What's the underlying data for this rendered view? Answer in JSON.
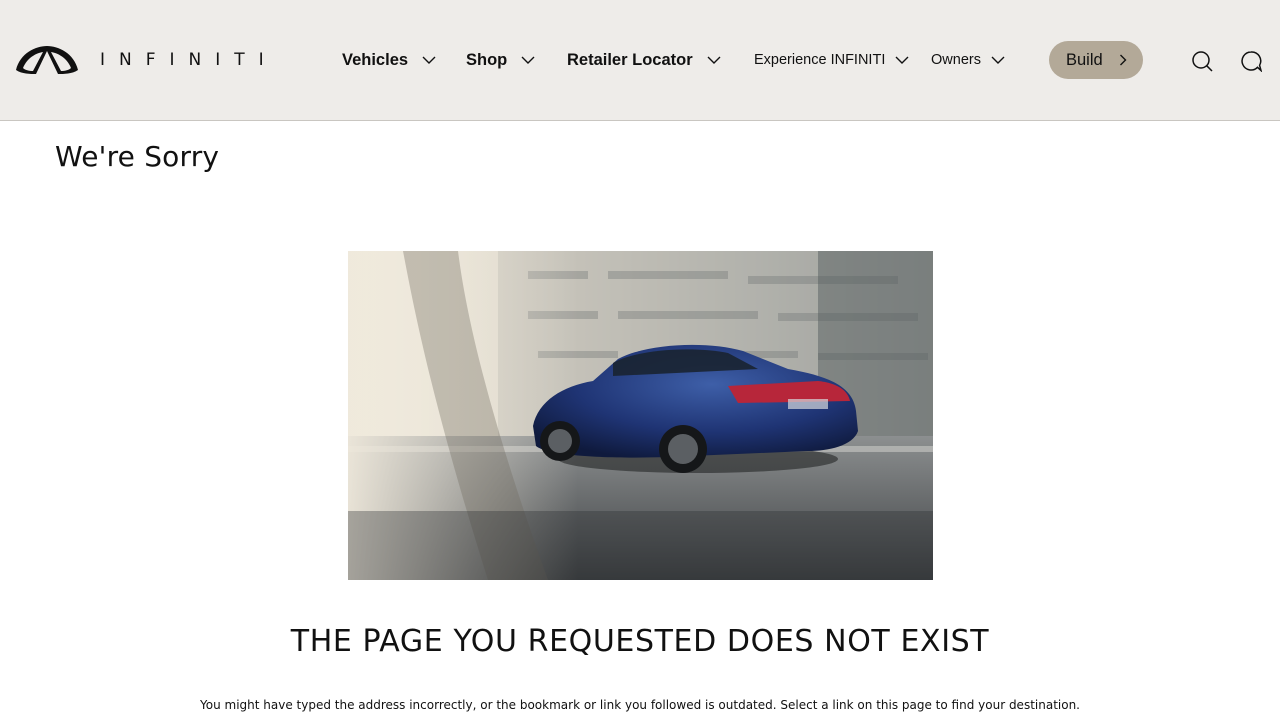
{
  "header": {
    "brand": "INFINITI",
    "nav": [
      {
        "label": "Vehicles",
        "has_dropdown": true
      },
      {
        "label": "Shop",
        "has_dropdown": true
      },
      {
        "label": "Retailer Locator",
        "has_dropdown": true
      },
      {
        "label": "Experience INFINITI",
        "has_dropdown": true
      },
      {
        "label": "Owners",
        "has_dropdown": true
      }
    ],
    "build_label": "Build",
    "icons": [
      "search-icon",
      "chat-icon"
    ]
  },
  "main": {
    "title": "We're Sorry",
    "hero_image": "blue-sedan-photo",
    "error_heading": "THE PAGE YOU REQUESTED DOES NOT EXIST",
    "error_body": "You might have typed the address incorrectly, or the bookmark or link you followed is outdated. Select a link on this page to find your destination."
  },
  "colors": {
    "header_bg": "#eeece9",
    "build_button": "#b3a998",
    "text": "#111111"
  }
}
